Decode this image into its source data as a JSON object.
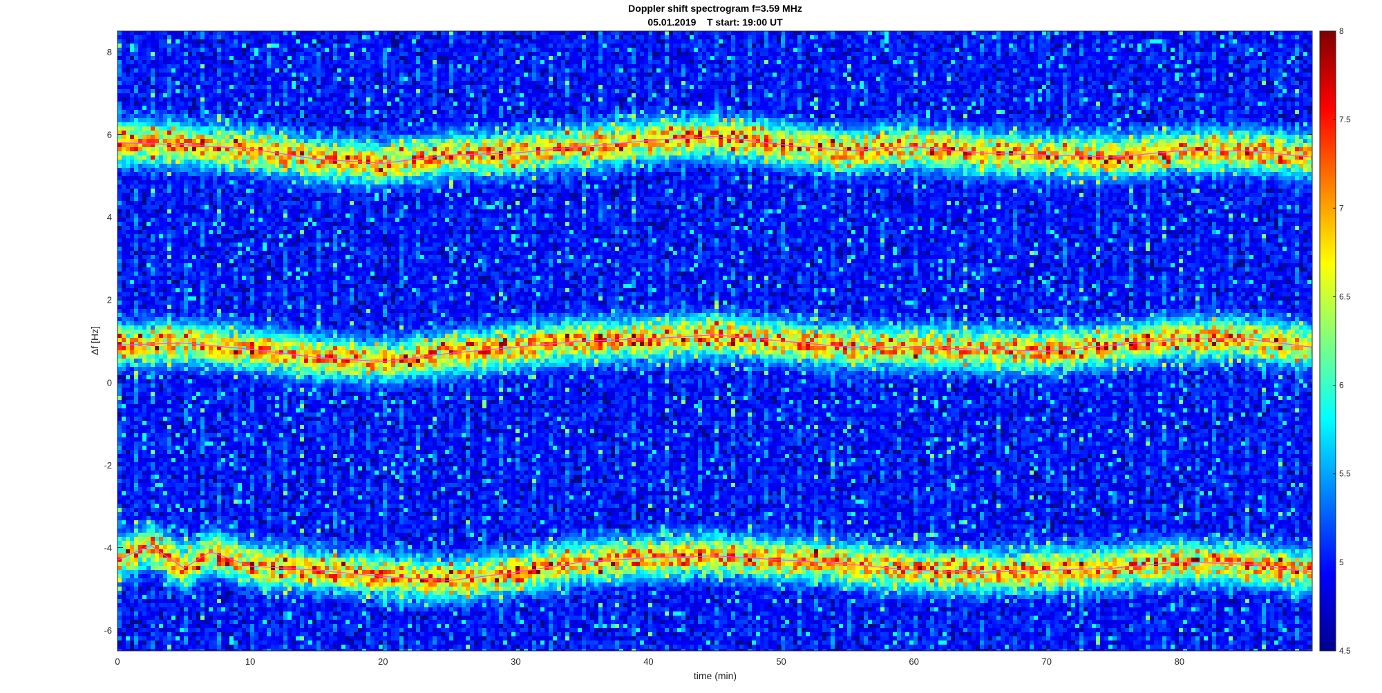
{
  "chart_data": {
    "type": "heatmap",
    "title": [
      "Doppler shift spectrogram f=3.59 MHz",
      "05.01.2019    T start: 19:00 UT"
    ],
    "xlabel": "time (min)",
    "ylabel": "Δf [Hz]",
    "xlim": [
      0,
      90
    ],
    "ylim": [
      -6.5,
      8.5
    ],
    "x_ticks": [
      0,
      10,
      20,
      30,
      40,
      50,
      60,
      70,
      80
    ],
    "y_ticks": [
      -6,
      -4,
      -2,
      0,
      2,
      4,
      6,
      8
    ],
    "colorbar": {
      "colormap": "jet",
      "range": [
        4.5,
        8
      ],
      "ticks": [
        4.5,
        5,
        5.5,
        6,
        6.5,
        7,
        7.5,
        8
      ]
    },
    "grid": false,
    "ridge_traces": [
      {
        "line_color": "#ff44ff",
        "x": [
          0,
          5,
          10,
          15,
          20,
          25,
          30,
          35,
          40,
          45,
          50,
          55,
          60,
          65,
          70,
          75,
          80,
          85,
          90
        ],
        "y": [
          5.8,
          5.75,
          5.65,
          5.4,
          5.3,
          5.5,
          5.55,
          5.7,
          5.85,
          5.95,
          5.75,
          5.6,
          5.7,
          5.55,
          5.5,
          5.45,
          5.6,
          5.6,
          5.45
        ]
      },
      {
        "line_color": "#ff44ff",
        "x": [
          0,
          5,
          10,
          15,
          20,
          25,
          30,
          35,
          40,
          45,
          50,
          55,
          60,
          65,
          70,
          75,
          80,
          85,
          90
        ],
        "y": [
          0.9,
          0.95,
          0.8,
          0.6,
          0.5,
          0.7,
          0.85,
          1.0,
          1.05,
          1.15,
          1.0,
          0.85,
          0.85,
          0.8,
          0.75,
          0.9,
          1.05,
          1.05,
          0.85
        ]
      },
      {
        "line_color": "#ff44ff",
        "x": [
          0,
          2.5,
          5,
          7,
          10,
          15,
          20,
          25,
          30,
          35,
          40,
          45,
          50,
          55,
          60,
          65,
          70,
          75,
          80,
          85,
          90
        ],
        "y": [
          -4.3,
          -3.95,
          -4.5,
          -4.1,
          -4.45,
          -4.55,
          -4.7,
          -4.8,
          -4.6,
          -4.35,
          -4.25,
          -4.2,
          -4.3,
          -4.4,
          -4.55,
          -4.6,
          -4.55,
          -4.5,
          -4.35,
          -4.4,
          -4.6
        ]
      }
    ]
  }
}
